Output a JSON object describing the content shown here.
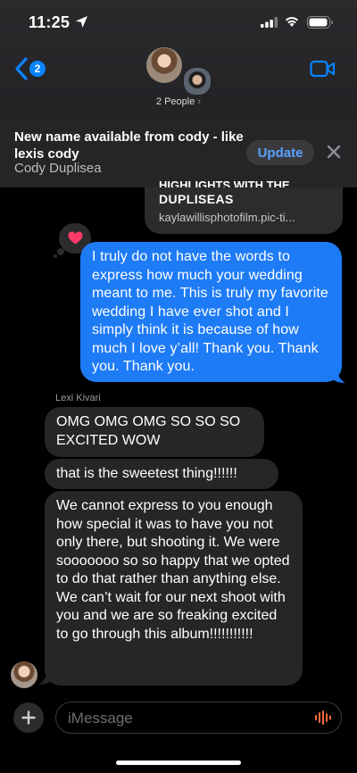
{
  "status_bar": {
    "time": "11:25"
  },
  "header": {
    "back_badge": "2",
    "group_label": "2 People",
    "video_icon": "video-camera-icon"
  },
  "banner": {
    "title": "New name available from cody - like lexis cody",
    "subtitle": "Cody Duplisea",
    "update_label": "Update"
  },
  "link_preview": {
    "title_cut": "HIGHLIGHTS WITH THE",
    "title": "DUPLISEAS",
    "url": "kaylawillisphotofilm.pic-ti..."
  },
  "tapback": {
    "icon": "heart-icon",
    "color": "#ff3b6a"
  },
  "messages": {
    "sent_1": "I truly do not have the words to express how much your wedding meant to me. This is truly my favorite wedding I have ever shot and I simply think it is because of how much I love y’all! Thank you. Thank you. Thank you.",
    "sender_name": "Lexi Kivari",
    "recv_1": "OMG OMG OMG SO SO SO EXCITED WOW",
    "recv_2": "that is the sweetest thing!!!!!!",
    "recv_3": "We cannot express to you enough how special it was to have you not only there, but shooting it. We were sooooooo so so happy that we opted to do that rather than anything else. We can’t wait for our next shoot with you and we are so freaking excited to go through this album!!!!!!!!!!!"
  },
  "composer": {
    "placeholder": "iMessage"
  },
  "colors": {
    "accent": "#0a84ff",
    "sent_bubble": "#1e7bf6",
    "received_bubble": "#262628"
  }
}
